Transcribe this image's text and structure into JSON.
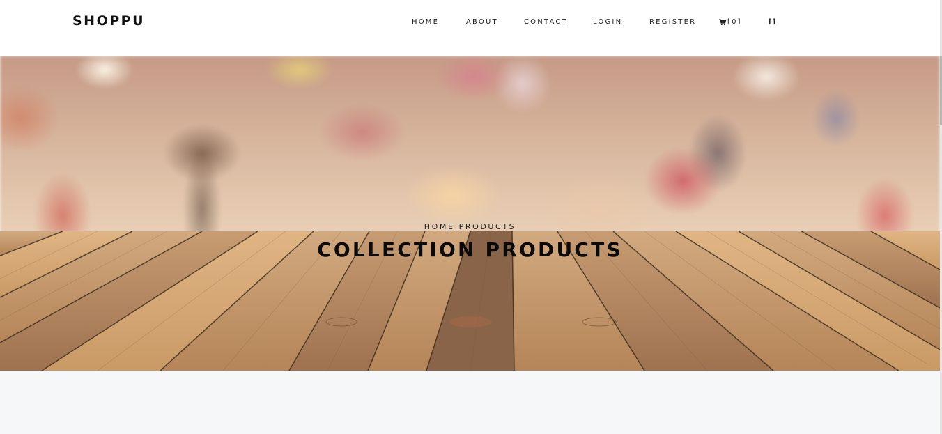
{
  "brand": "SHOPPU",
  "nav": {
    "home": "HOME",
    "about": "ABOUT",
    "contact": "CONTACT",
    "login": "LOGIN",
    "register": "REGISTER",
    "cart": "[0]",
    "user": "[]"
  },
  "hero": {
    "breadcrumb": "HOME PRODUCTS",
    "title": "COLLECTION PRODUCTS"
  },
  "icons": {
    "cart": "shopping-cart-icon"
  },
  "colors": {
    "header_bg": "#ffffff",
    "page_bg": "#f6f7f9",
    "text": "#111111"
  }
}
